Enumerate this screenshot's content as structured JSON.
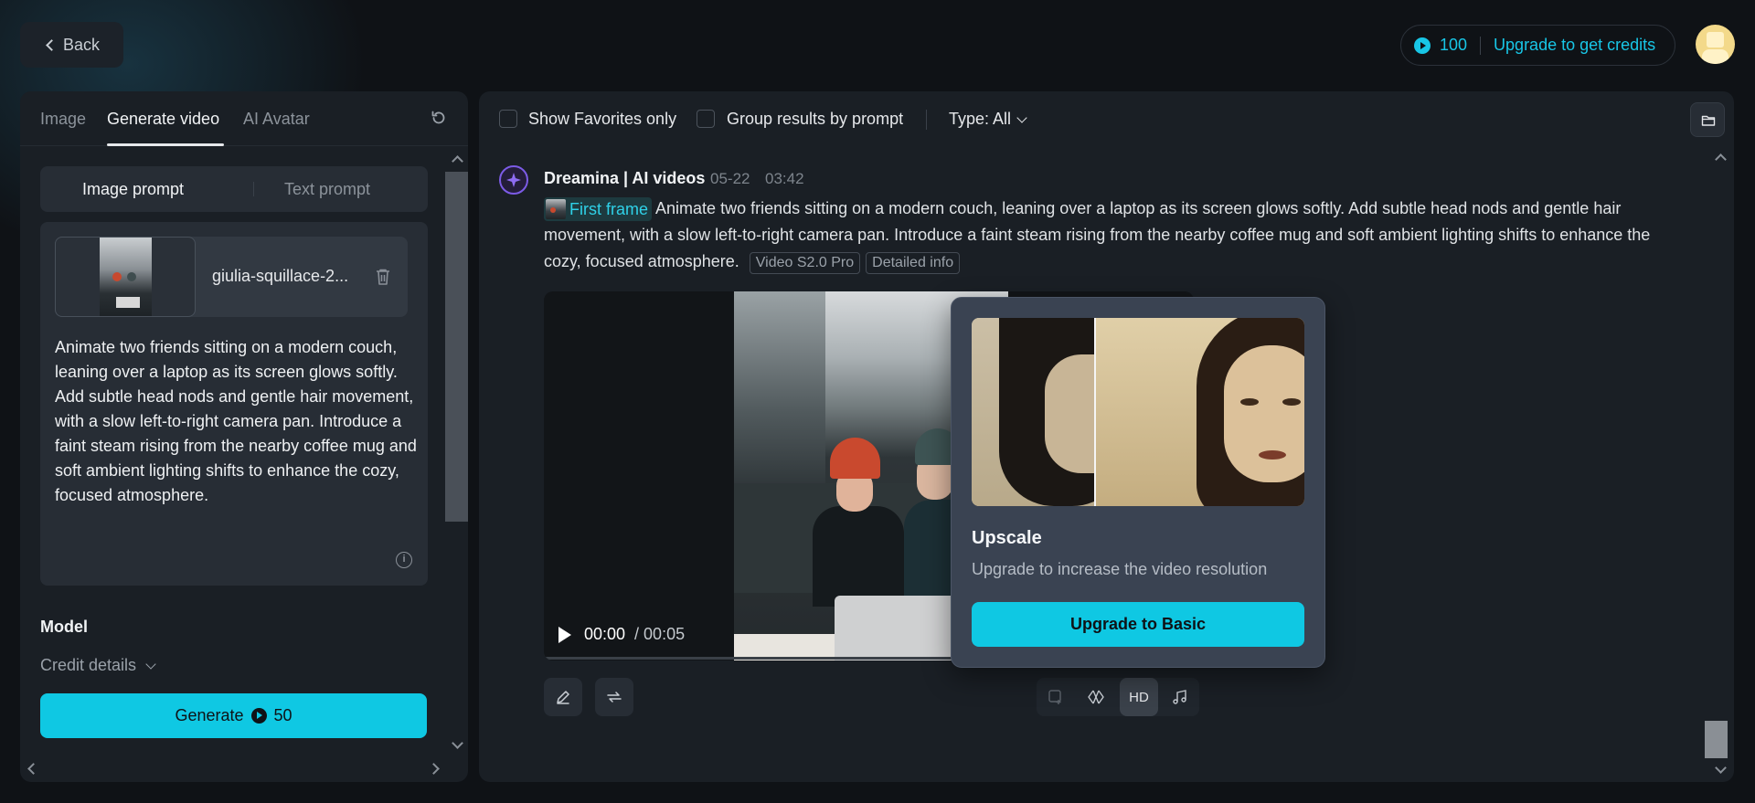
{
  "top": {
    "back_label": "Back",
    "credits_count": "100",
    "upgrade_label": "Upgrade to get credits"
  },
  "left": {
    "tabs": [
      {
        "label": "Image"
      },
      {
        "label": "Generate video"
      },
      {
        "label": "AI Avatar"
      }
    ],
    "active_tab": "Generate video",
    "prompt_modes": {
      "image": "Image prompt",
      "text": "Text prompt"
    },
    "active_mode": "Image prompt",
    "file_name": "giulia-squillace-2...",
    "prompt": "Animate two friends sitting on a modern couch, leaning over a laptop as its screen glows softly. Add subtle head nods and gentle hair movement, with a slow left-to-right camera pan. Introduce a faint steam rising from the nearby coffee mug and soft ambient lighting shifts to enhance the cozy, focused atmosphere.",
    "info_glyph": "i",
    "model_label": "Model",
    "credit_details_label": "Credit details",
    "generate_label": "Generate",
    "generate_cost": "50"
  },
  "right": {
    "filters": {
      "favorites_label": "Show Favorites only",
      "favorites_checked": false,
      "group_label": "Group results by prompt",
      "group_checked": false,
      "type_label": "Type: All"
    },
    "generation": {
      "author": "Dreamina | AI videos",
      "date": "05-22",
      "time": "03:42",
      "first_frame_label": "First frame",
      "description": "Animate two friends sitting on a modern couch, leaning over a laptop as its screen glows softly. Add subtle head nods and gentle hair movement, with a slow left-to-right camera pan. Introduce a faint steam rising from the nearby coffee mug and soft ambient lighting shifts to enhance the cozy, focused atmosphere.",
      "tags": [
        "Video S2.0 Pro",
        "Detailed info"
      ],
      "video": {
        "current_time": "00:00",
        "duration": "/ 00:05",
        "progress": 0
      },
      "hd_label": "HD"
    },
    "popover": {
      "title": "Upscale",
      "subtitle": "Upgrade to increase the video resolution",
      "button_label": "Upgrade to Basic"
    }
  },
  "colors": {
    "accent": "#0fc8e3",
    "background": "#0f1216",
    "panel": "#1a1f25"
  },
  "icons": [
    "chevron-left-icon",
    "coin-icon",
    "avatar-icon",
    "reset-icon",
    "trash-icon",
    "info-icon",
    "chevron-down-icon",
    "folder-icon",
    "dreamina-logo-icon",
    "play-icon",
    "edit-icon",
    "regenerate-icon",
    "extend-icon",
    "interpolate-icon",
    "music-icon"
  ]
}
